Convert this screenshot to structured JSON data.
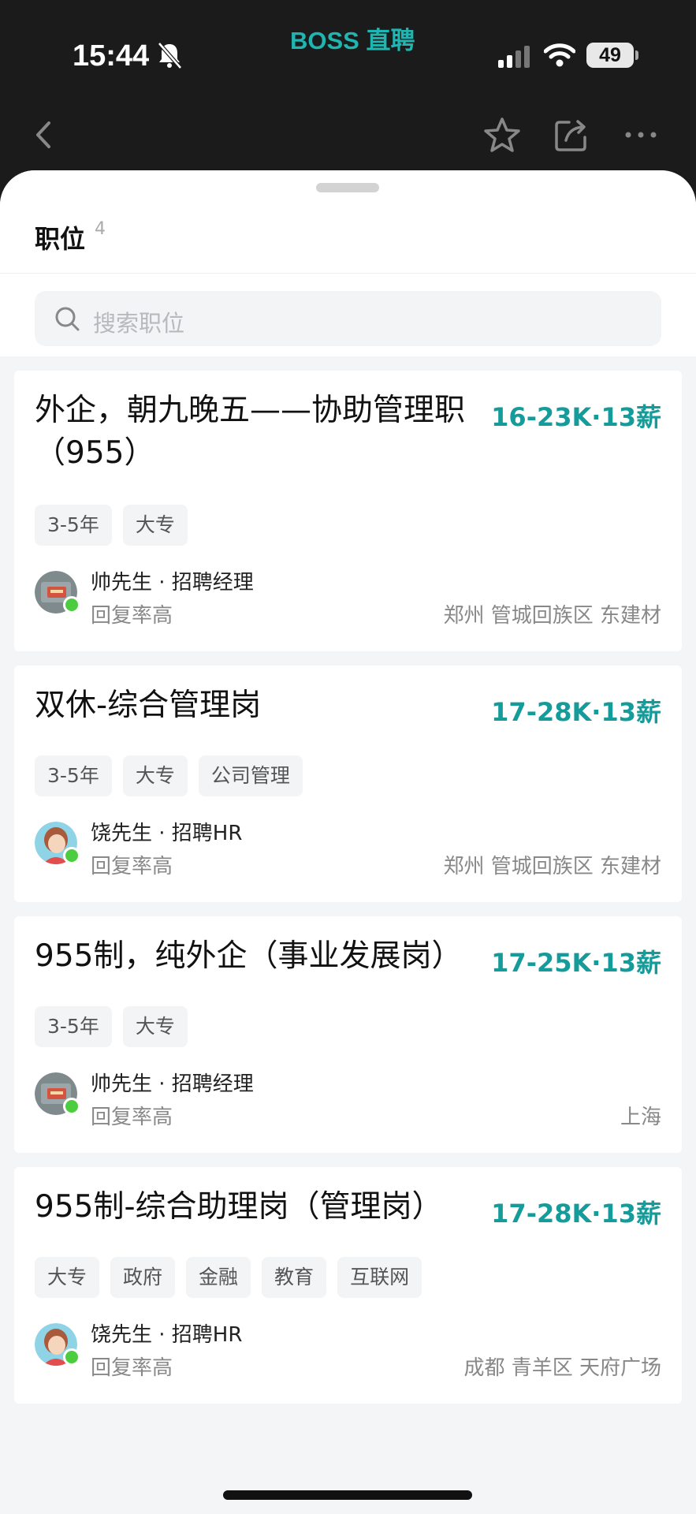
{
  "status_bar": {
    "time": "15:44",
    "battery": "49"
  },
  "app_brand": "BOSS 直聘",
  "section": {
    "title": "职位",
    "count": "4"
  },
  "search": {
    "placeholder": "搜索职位"
  },
  "colors": {
    "accent": "#159c9a",
    "brand": "#1fb5b0",
    "online": "#4ccd3f",
    "dark_bg": "#1b1b1b"
  },
  "jobs": [
    {
      "title": "外企，朝九晚五——协助管理职（955）",
      "salary": "16-23K·13薪",
      "tags": [
        "3-5年",
        "大专"
      ],
      "recruiter": "帅先生 · 招聘经理",
      "reply": "回复率高",
      "location": "郑州 管城回族区 东建材"
    },
    {
      "title": "双休-综合管理岗",
      "salary": "17-28K·13薪",
      "tags": [
        "3-5年",
        "大专",
        "公司管理"
      ],
      "recruiter": "饶先生 · 招聘HR",
      "reply": "回复率高",
      "location": "郑州 管城回族区 东建材"
    },
    {
      "title": "955制，纯外企（事业发展岗）",
      "salary": "17-25K·13薪",
      "tags": [
        "3-5年",
        "大专"
      ],
      "recruiter": "帅先生 · 招聘经理",
      "reply": "回复率高",
      "location": "上海"
    },
    {
      "title": "955制-综合助理岗（管理岗）",
      "salary": "17-28K·13薪",
      "tags": [
        "大专",
        "政府",
        "金融",
        "教育",
        "互联网"
      ],
      "recruiter": "饶先生 · 招聘HR",
      "reply": "回复率高",
      "location": "成都 青羊区 天府广场"
    }
  ]
}
